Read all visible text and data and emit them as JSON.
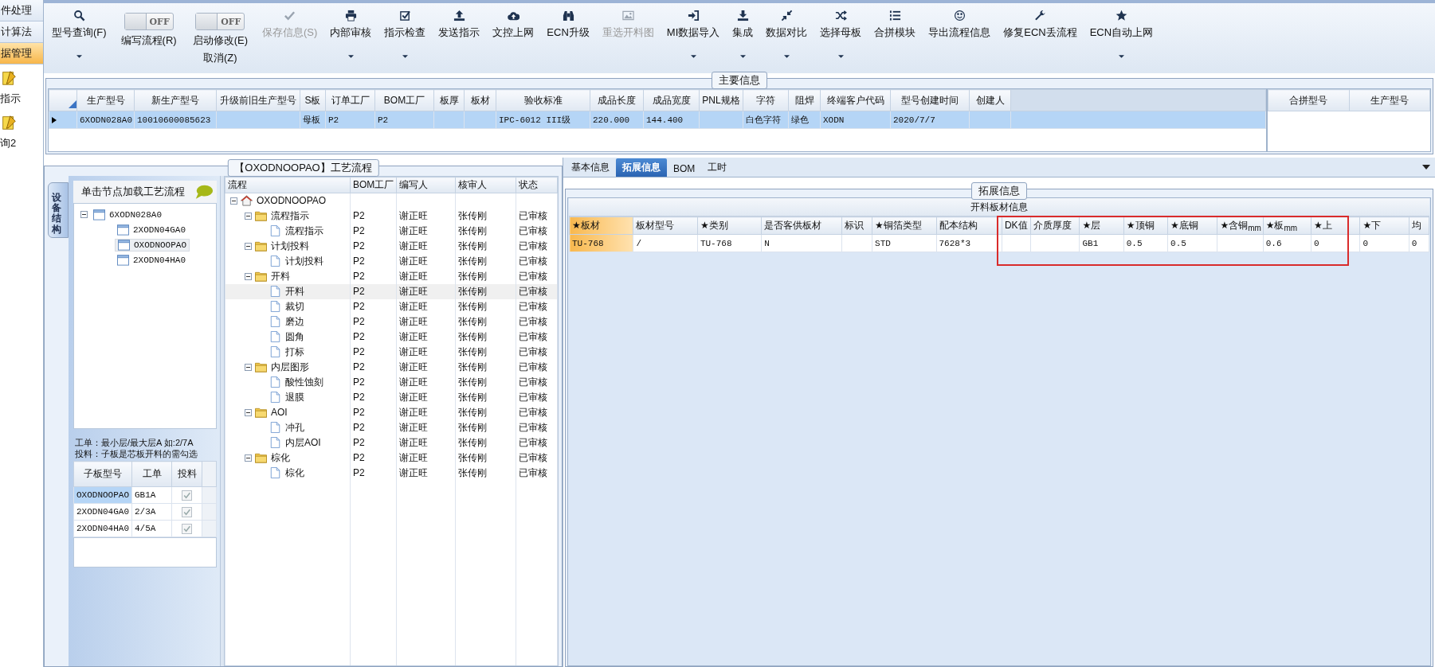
{
  "sidebar": {
    "items": [
      {
        "kind": "bar",
        "label": "件处理",
        "selected": false
      },
      {
        "kind": "bar",
        "label": "计算法",
        "selected": false
      },
      {
        "kind": "bar",
        "label": "据管理",
        "selected": true
      },
      {
        "kind": "launcher",
        "label": "指示",
        "selected": false
      },
      {
        "kind": "launcher",
        "label": "询2",
        "selected": false
      }
    ]
  },
  "toolbar": [
    {
      "kind": "button",
      "label": "型号查询(F)",
      "dropdown": true,
      "disabled": false
    },
    {
      "kind": "toggle",
      "state_text": "OFF",
      "on": false,
      "label": "编写流程(R)"
    },
    {
      "kind": "toggle",
      "state_text": "OFF",
      "on": false,
      "label": "启动修改(E)",
      "sublabel": "取消(Z)"
    },
    {
      "kind": "button",
      "label": "保存信息(S)",
      "dropdown": false,
      "disabled": true
    },
    {
      "kind": "button",
      "label": "内部审核",
      "dropdown": true,
      "disabled": false
    },
    {
      "kind": "button",
      "label": "指示检查",
      "dropdown": true,
      "disabled": false
    },
    {
      "kind": "button",
      "label": "发送指示",
      "dropdown": false,
      "disabled": false
    },
    {
      "kind": "button",
      "label": "文控上网",
      "dropdown": false,
      "disabled": false
    },
    {
      "kind": "button",
      "label": "ECN升级",
      "dropdown": false,
      "disabled": false
    },
    {
      "kind": "button",
      "label": "重选开料图",
      "dropdown": false,
      "disabled": true
    },
    {
      "kind": "button",
      "label": "MI数据导入",
      "dropdown": true,
      "disabled": false
    },
    {
      "kind": "button",
      "label": "集成",
      "dropdown": true,
      "disabled": false
    },
    {
      "kind": "button",
      "label": "数据对比",
      "dropdown": true,
      "disabled": false
    },
    {
      "kind": "button",
      "label": "选择母板",
      "dropdown": true,
      "disabled": false
    },
    {
      "kind": "button",
      "label": "合拼模块",
      "dropdown": false,
      "disabled": false
    },
    {
      "kind": "button",
      "label": "导出流程信息",
      "dropdown": false,
      "disabled": false
    },
    {
      "kind": "button",
      "label": "修复ECN丢流程",
      "dropdown": false,
      "disabled": false
    },
    {
      "kind": "button",
      "label": "ECN自动上网",
      "dropdown": true,
      "disabled": false
    }
  ],
  "main_info": {
    "title": "主要信息",
    "table": {
      "columns": [
        "生产型号",
        "新生产型号",
        "升级前旧生产型号",
        "S板",
        "订单工厂",
        "BOM工厂",
        "板厚",
        "板材",
        "验收标准",
        "成品长度",
        "成品宽度",
        "PNL规格",
        "字符",
        "阻焊",
        "终端客户代码",
        "型号创建时间",
        "创建人"
      ],
      "rows": [
        {
          "selected": true,
          "cells": [
            "6XODN028A0",
            "10010600085623",
            "",
            "母板",
            "P2",
            "P2",
            "",
            "",
            "IPC-6012 III级",
            "220.000",
            "144.400",
            "",
            "白色字符",
            "绿色",
            "XODN",
            "2020/7/7",
            ""
          ]
        }
      ]
    },
    "side_table": {
      "columns": [
        "合拼型号",
        "生产型号"
      ]
    }
  },
  "process": {
    "title": "【OXODNOOPAO】工艺流程",
    "side_tab": "设备结构",
    "device_panel": {
      "header": "单击节点加载工艺流程",
      "tree": [
        {
          "label": "6XODN028A0",
          "expanded": true,
          "selected": false,
          "children": [
            {
              "label": "2XODN04GA0",
              "selected": false
            },
            {
              "label": "OXODNOOPAO",
              "selected": true
            },
            {
              "label": "2XODN04HA0",
              "selected": false
            }
          ]
        }
      ]
    },
    "hints": [
      "工单：最小层/最大层A 如:2/7A",
      "投料：子板是芯板开料的需勾选"
    ],
    "board_table": {
      "columns": [
        "子板型号",
        "工单",
        "投料"
      ],
      "rows": [
        {
          "selected": true,
          "cells": [
            "OXODNOOPAO",
            "GB1A"
          ],
          "checked": true
        },
        {
          "selected": false,
          "cells": [
            "2XODN04GA0",
            "2/3A"
          ],
          "checked": true
        },
        {
          "selected": false,
          "cells": [
            "2XODN04HA0",
            "4/5A"
          ],
          "checked": true
        }
      ]
    },
    "flow": {
      "columns": [
        "流程",
        "BOM工厂",
        "编写人",
        "核审人",
        "状态"
      ],
      "tree": [
        {
          "kind": "root",
          "label": "OXODNOOPAO",
          "expanded": true,
          "selected": false,
          "children": [
            {
              "kind": "folder",
              "label": "流程指示",
              "expanded": true,
              "selected": false,
              "cells": [
                "P2",
                "谢正旺",
                "张传刚",
                "已审核"
              ],
              "children": [
                {
                  "kind": "file",
                  "label": "流程指示",
                  "selected": false,
                  "cells": [
                    "P2",
                    "谢正旺",
                    "张传刚",
                    "已审核"
                  ]
                }
              ]
            },
            {
              "kind": "folder",
              "label": "计划投料",
              "expanded": true,
              "selected": false,
              "cells": [
                "P2",
                "谢正旺",
                "张传刚",
                "已审核"
              ],
              "children": [
                {
                  "kind": "file",
                  "label": "计划投料",
                  "selected": false,
                  "cells": [
                    "P2",
                    "谢正旺",
                    "张传刚",
                    "已审核"
                  ]
                }
              ]
            },
            {
              "kind": "folder",
              "label": "开料",
              "expanded": true,
              "selected": false,
              "cells": [
                "P2",
                "谢正旺",
                "张传刚",
                "已审核"
              ],
              "children": [
                {
                  "kind": "file",
                  "label": "开料",
                  "selected": true,
                  "cells": [
                    "P2",
                    "谢正旺",
                    "张传刚",
                    "已审核"
                  ]
                },
                {
                  "kind": "file",
                  "label": "裁切",
                  "selected": false,
                  "cells": [
                    "P2",
                    "谢正旺",
                    "张传刚",
                    "已审核"
                  ]
                },
                {
                  "kind": "file",
                  "label": "磨边",
                  "selected": false,
                  "cells": [
                    "P2",
                    "谢正旺",
                    "张传刚",
                    "已审核"
                  ]
                },
                {
                  "kind": "file",
                  "label": "圆角",
                  "selected": false,
                  "cells": [
                    "P2",
                    "谢正旺",
                    "张传刚",
                    "已审核"
                  ]
                },
                {
                  "kind": "file",
                  "label": "打标",
                  "selected": false,
                  "cells": [
                    "P2",
                    "谢正旺",
                    "张传刚",
                    "已审核"
                  ]
                }
              ]
            },
            {
              "kind": "folder",
              "label": "内层图形",
              "expanded": true,
              "selected": false,
              "cells": [
                "P2",
                "谢正旺",
                "张传刚",
                "已审核"
              ],
              "children": [
                {
                  "kind": "file",
                  "label": "酸性蚀刻",
                  "selected": false,
                  "cells": [
                    "P2",
                    "谢正旺",
                    "张传刚",
                    "已审核"
                  ]
                },
                {
                  "kind": "file",
                  "label": "退膜",
                  "selected": false,
                  "cells": [
                    "P2",
                    "谢正旺",
                    "张传刚",
                    "已审核"
                  ]
                }
              ]
            },
            {
              "kind": "folder",
              "label": "AOI",
              "expanded": true,
              "selected": false,
              "cells": [
                "P2",
                "谢正旺",
                "张传刚",
                "已审核"
              ],
              "children": [
                {
                  "kind": "file",
                  "label": "冲孔",
                  "selected": false,
                  "cells": [
                    "P2",
                    "谢正旺",
                    "张传刚",
                    "已审核"
                  ]
                },
                {
                  "kind": "file",
                  "label": "内层AOI",
                  "selected": false,
                  "cells": [
                    "P2",
                    "谢正旺",
                    "张传刚",
                    "已审核"
                  ]
                }
              ]
            },
            {
              "kind": "folder",
              "label": "棕化",
              "expanded": true,
              "selected": false,
              "cells": [
                "P2",
                "谢正旺",
                "张传刚",
                "已审核"
              ],
              "children": [
                {
                  "kind": "file",
                  "label": "棕化",
                  "selected": false,
                  "cells": [
                    "P2",
                    "谢正旺",
                    "张传刚",
                    "已审核"
                  ]
                }
              ]
            }
          ]
        }
      ]
    }
  },
  "extension": {
    "tabs": [
      {
        "label": "基本信息",
        "selected": false
      },
      {
        "label": "拓展信息",
        "selected": true
      },
      {
        "label": "BOM",
        "selected": false
      },
      {
        "label": "工时",
        "selected": false
      }
    ],
    "group_title": "拓展信息",
    "table": {
      "title": "开料板材信息",
      "columns": [
        {
          "label": "★板材",
          "selected": true
        },
        {
          "label": "板材型号",
          "selected": false
        },
        {
          "label": "★类别",
          "selected": false
        },
        {
          "label": "是否客供板材",
          "selected": false
        },
        {
          "label": "标识",
          "selected": false
        },
        {
          "label": "★铜箔类型",
          "selected": false
        },
        {
          "label": "配本结构",
          "selected": false
        },
        {
          "label": "DK值",
          "selected": false
        },
        {
          "label": "介质厚度",
          "selected": false
        },
        {
          "label": "★层",
          "selected": false
        },
        {
          "label": "★顶铜",
          "selected": false
        },
        {
          "label": "★底铜",
          "selected": false
        },
        {
          "label": "★含铜$_{mm}$",
          "selected": false
        },
        {
          "label": "★板$_{mm}$",
          "selected": false
        },
        {
          "label": "★上",
          "selected": false
        },
        {
          "label": "★下",
          "selected": false
        },
        {
          "label": "均",
          "selected": false
        }
      ],
      "rows": [
        {
          "selected": true,
          "cells": [
            "TU-768",
            "/",
            "TU-768",
            "N",
            "",
            "STD",
            "7628*3",
            "",
            "",
            "GB1",
            "0.5",
            "0.5",
            "",
            "0.6",
            "0",
            "0",
            "0"
          ]
        }
      ]
    },
    "overlays": [
      {
        "kind": "rectangle"
      }
    ]
  }
}
